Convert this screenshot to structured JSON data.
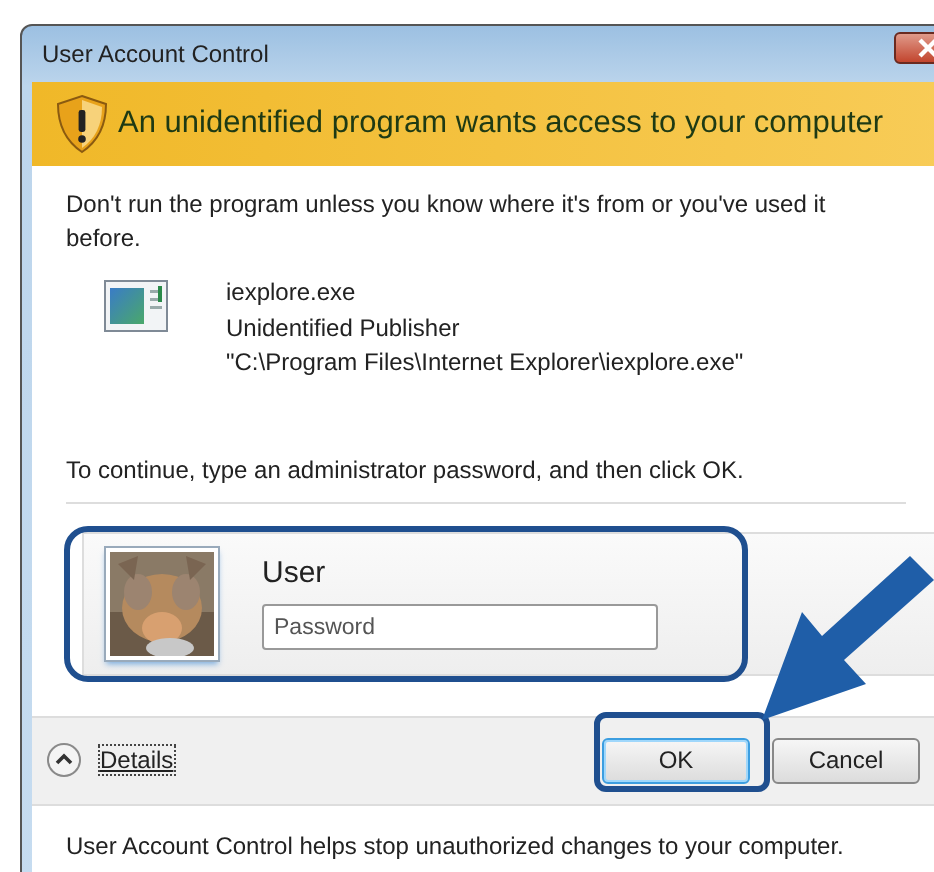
{
  "window": {
    "title": "User Account Control"
  },
  "banner": {
    "heading": "An unidentified program wants access to your computer"
  },
  "message": "Don't run the program unless you know where it's from or you've used it before.",
  "program": {
    "name": "iexplore.exe",
    "publisher": "Unidentified Publisher",
    "path": "\"C:\\Program Files\\Internet Explorer\\iexplore.exe\""
  },
  "instruction": "To continue, type an administrator password, and then click OK.",
  "credential": {
    "user": "User",
    "password": {
      "placeholder": "Password"
    }
  },
  "details": {
    "label": "Details"
  },
  "buttons": [
    {
      "label": "OK",
      "focused": true
    },
    {
      "label": "Cancel",
      "focused": false
    }
  ],
  "footer": "User Account Control helps stop unauthorized changes to your computer."
}
